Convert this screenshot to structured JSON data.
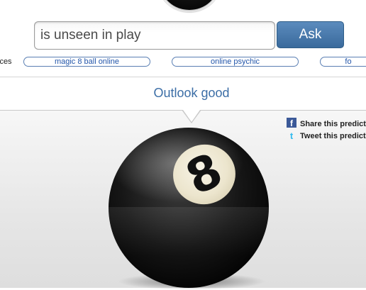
{
  "search": {
    "question_value": "is unseen in play",
    "ask_label": "Ask"
  },
  "links": {
    "services_label": "ices",
    "items": [
      "magic 8 ball online",
      "online psychic",
      "fo"
    ]
  },
  "answer": {
    "text": "Outlook good"
  },
  "share": {
    "facebook_label": "Share this predicti",
    "twitter_label": "Tweet this predicti"
  },
  "ball": {
    "number": "8"
  },
  "icons": {
    "facebook": "facebook-icon",
    "twitter": "twitter-icon"
  }
}
